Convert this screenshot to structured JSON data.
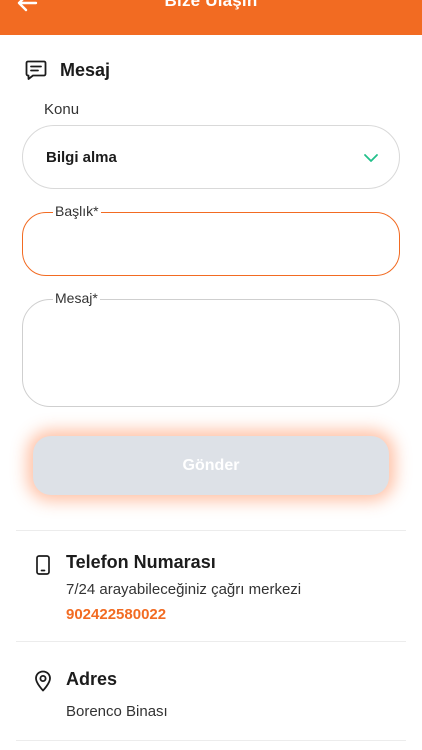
{
  "header": {
    "title": "Bize Ulaşın",
    "back_icon": "arrow-left-icon",
    "background_color": "#f26b22"
  },
  "section": {
    "title": "Mesaj",
    "icon": "message-icon"
  },
  "form": {
    "topic_label": "Konu",
    "topic_value": "Bilgi alma",
    "topic_icon": "chevron-down-icon",
    "title_label": "Başlık*",
    "title_value": "",
    "message_label": "Mesaj*",
    "message_value": "",
    "submit_label": "Gönder"
  },
  "contact": {
    "phone": {
      "icon": "phone-icon",
      "title": "Telefon Numarası",
      "description": "7/24 arayabileceğiniz çağrı merkezi",
      "number": "902422580022"
    },
    "address": {
      "icon": "location-pin-icon",
      "title": "Adres",
      "text": "Borenco Binası"
    }
  },
  "colors": {
    "accent": "#f26b22",
    "chevron": "#22c08a",
    "button_disabled": "#dde1e7"
  }
}
